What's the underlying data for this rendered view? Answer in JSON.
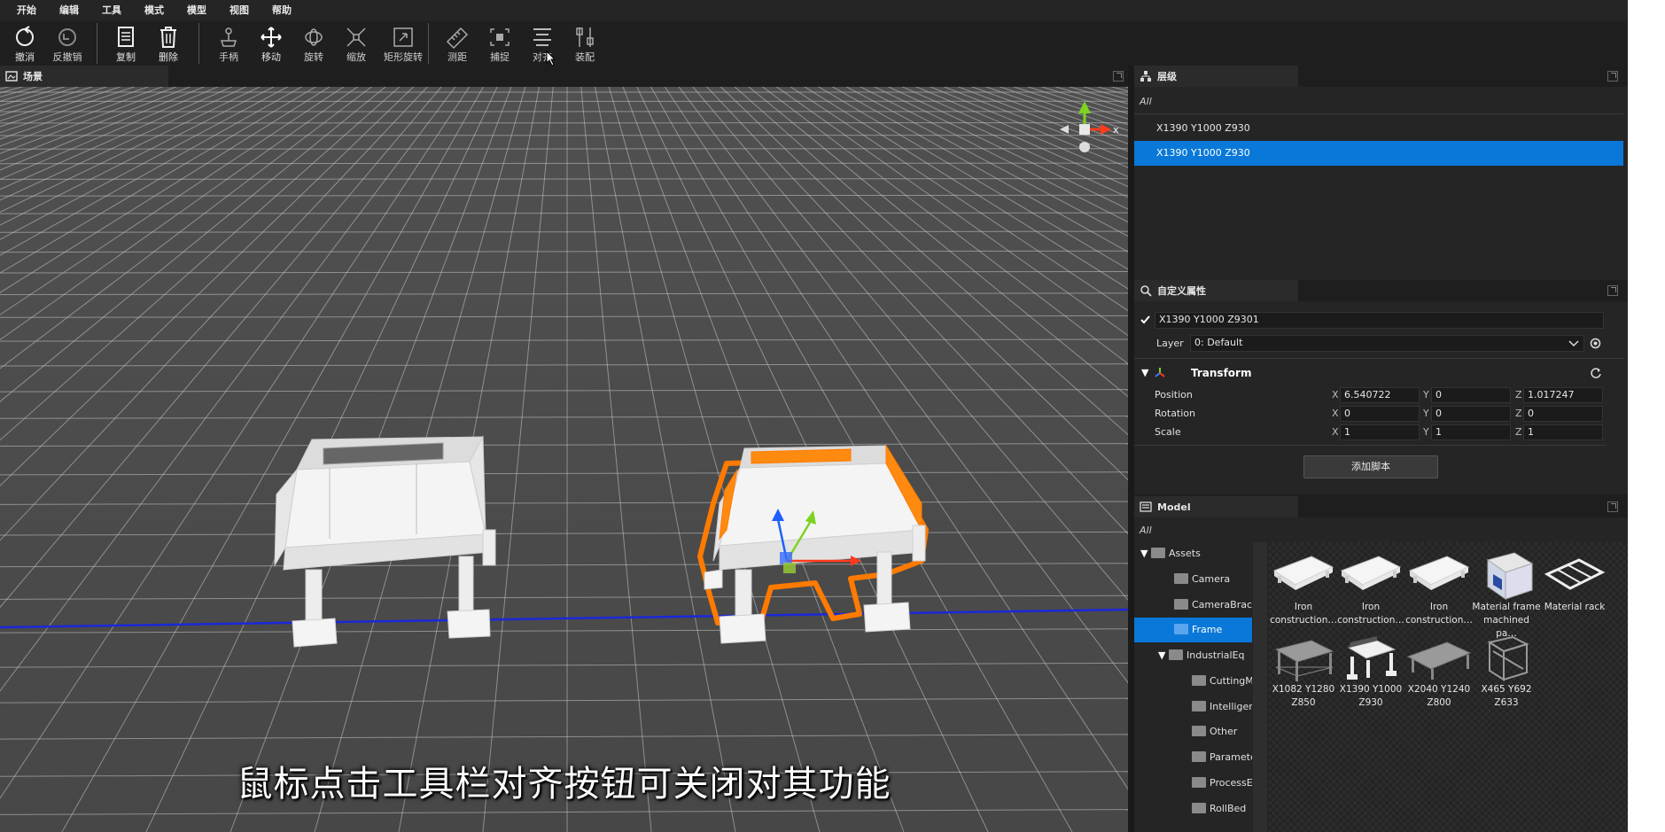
{
  "menu": [
    "开始",
    "编辑",
    "工具",
    "模式",
    "模型",
    "视图",
    "帮助"
  ],
  "toolbar": {
    "undo": "撤消",
    "redo": "反撤销",
    "copy": "复制",
    "delete": "删除",
    "handle": "手柄",
    "move": "移动",
    "rotate": "旋转",
    "scale": "缩放",
    "rect_rotate": "矩形旋转",
    "measure": "测距",
    "snap": "捕捉",
    "align": "对齐",
    "assemble": "装配"
  },
  "scene": {
    "title": "场景",
    "subtitle": "鼠标点击工具栏对齐按钮可关闭对其功能",
    "gizmo_axis_label": "x"
  },
  "hierarchy": {
    "title": "层级",
    "filter_placeholder": "All",
    "items": [
      {
        "label": "X1390 Y1000 Z930",
        "selected": false
      },
      {
        "label": "X1390 Y1000 Z930",
        "selected": true
      }
    ]
  },
  "properties": {
    "title": "自定义属性",
    "object_name": "X1390 Y1000 Z9301",
    "layer_label": "Layer",
    "layer_value": "0: Default",
    "transform_title": "Transform",
    "rows": [
      {
        "label": "Position",
        "x": "6.540722",
        "y": "0",
        "z": "1.017247"
      },
      {
        "label": "Rotation",
        "x": "0",
        "y": "0",
        "z": "0"
      },
      {
        "label": "Scale",
        "x": "1",
        "y": "1",
        "z": "1"
      }
    ],
    "axis_x": "X",
    "axis_y": "Y",
    "axis_z": "Z",
    "add_script": "添加脚本"
  },
  "model": {
    "title": "Model",
    "filter_placeholder": "All",
    "tree": [
      {
        "label": "Assets",
        "expanded": true
      },
      {
        "label": "Camera"
      },
      {
        "label": "CameraBrac"
      },
      {
        "label": "Frame",
        "selected": true
      },
      {
        "label": "IndustrialEq",
        "expanded": true
      },
      {
        "label": "CuttingM"
      },
      {
        "label": "Intelliger"
      },
      {
        "label": "Other"
      },
      {
        "label": "Paramete"
      },
      {
        "label": "ProcessE"
      },
      {
        "label": "RollBed"
      }
    ],
    "assets": [
      {
        "line1": "Iron",
        "line2": "construction…"
      },
      {
        "line1": "Iron",
        "line2": "construction…"
      },
      {
        "line1": "Iron",
        "line2": "construction…"
      },
      {
        "line1": "Material frame",
        "line2": "machined pa…"
      },
      {
        "line1": "Material rack",
        "line2": ""
      },
      {
        "line1": "X1082 Y1280",
        "line2": "Z850"
      },
      {
        "line1": "X1390 Y1000",
        "line2": "Z930"
      },
      {
        "line1": "X2040 Y1240",
        "line2": "Z800"
      },
      {
        "line1": "X465 Y692",
        "line2": "Z633"
      }
    ]
  }
}
